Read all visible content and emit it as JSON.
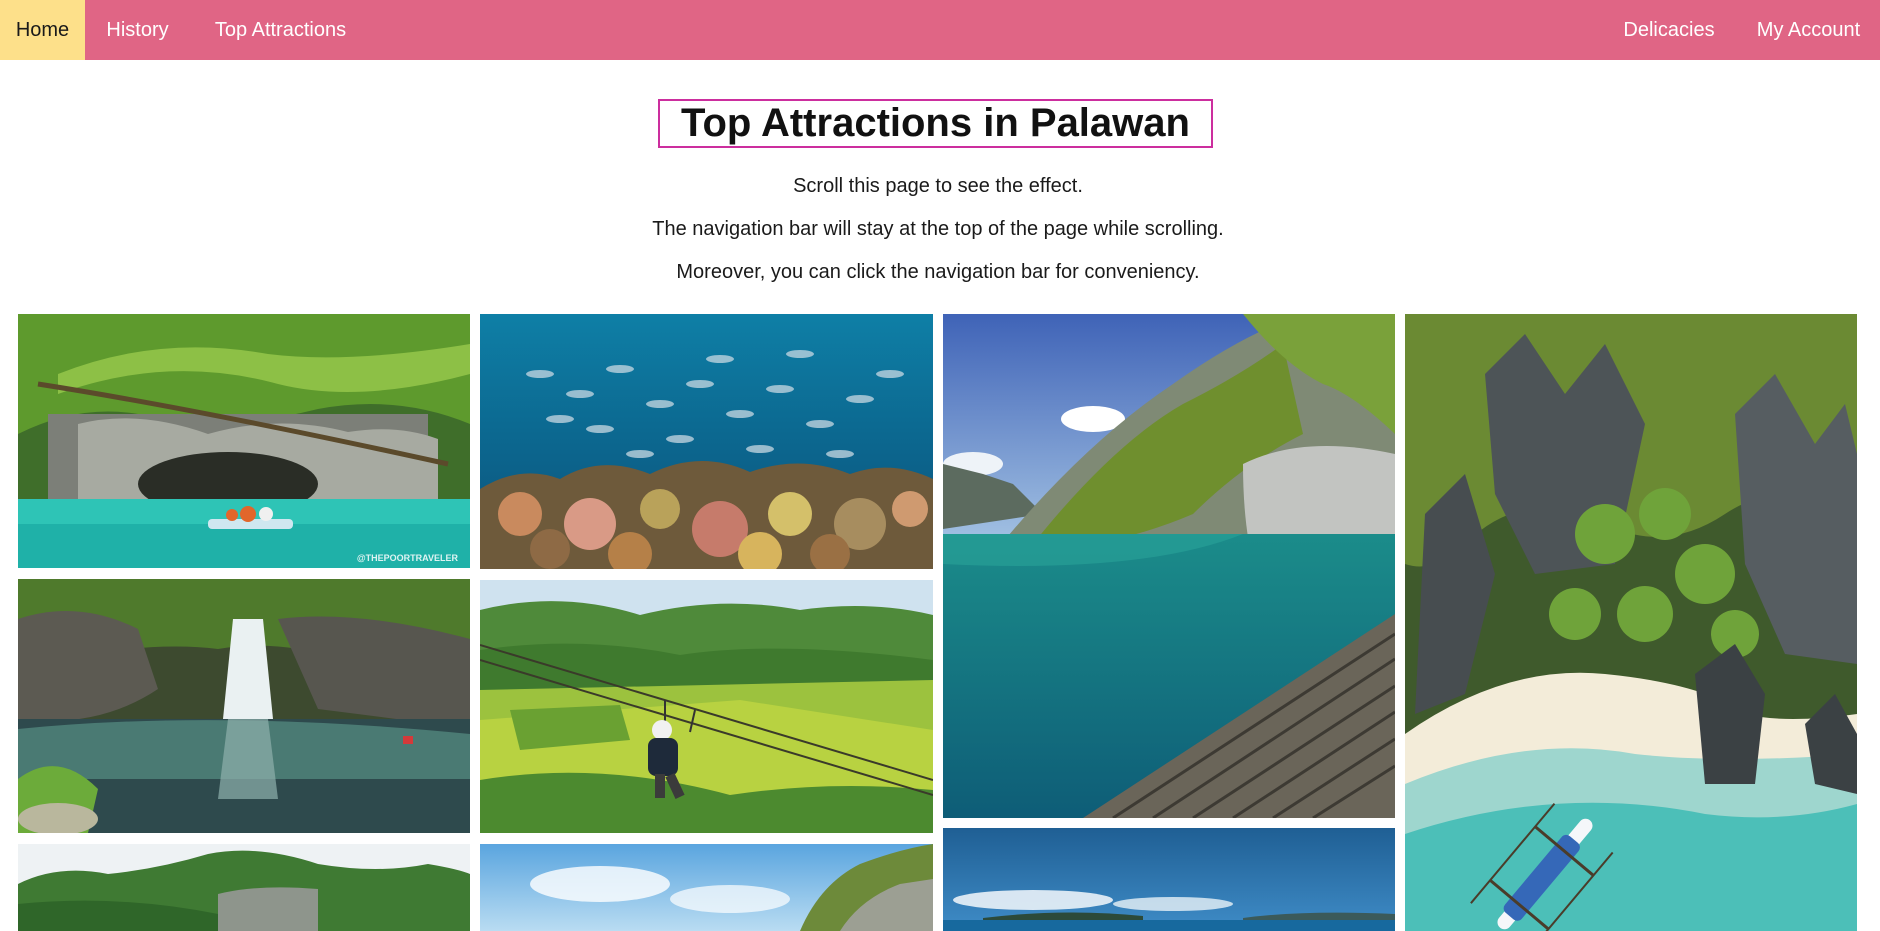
{
  "nav": {
    "left": [
      "Home",
      "History",
      "Top Attractions"
    ],
    "right": [
      "Delicacies",
      "My Account"
    ],
    "active": "Home",
    "bar_color": "#e06585",
    "active_color": "#fde08a"
  },
  "header": {
    "title": "Top Attractions in Palawan",
    "lines": [
      "Scroll this page to see the effect.",
      "The navigation bar will stay at the top of the page while scrolling.",
      "Moreover, you can click the navigation bar for conveniency."
    ]
  },
  "gallery": {
    "photos": [
      {
        "subject": "underground-river-boat",
        "watermark": "@THEPOORTRAVELER"
      },
      {
        "subject": "fish-school-coral-reef"
      },
      {
        "subject": "limestone-lagoon-boardwalk"
      },
      {
        "subject": "limestone-cliffs-beach-outrigger"
      },
      {
        "subject": "waterfall-pool"
      },
      {
        "subject": "zipline-rice-fields"
      },
      {
        "subject": "green-hills-limestone"
      },
      {
        "subject": "sky-cliff-greenery"
      },
      {
        "subject": "blue-sea-horizon"
      }
    ]
  }
}
